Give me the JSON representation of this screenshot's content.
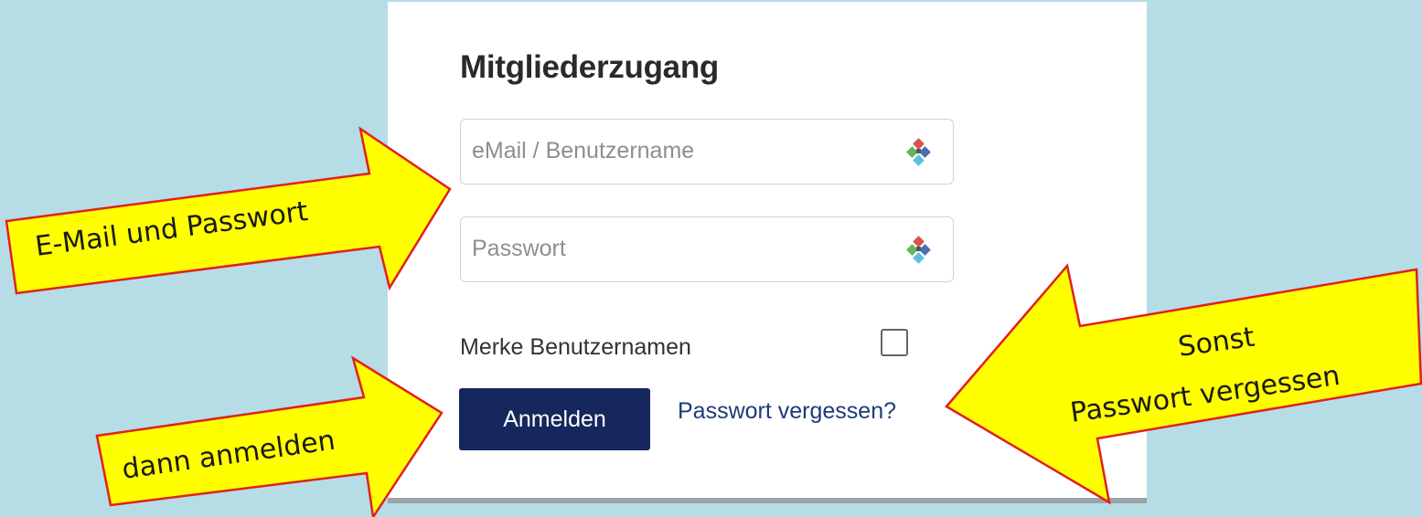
{
  "login": {
    "title": "Mitgliederzugang",
    "email_placeholder": "eMail / Benutzername",
    "password_placeholder": "Passwort",
    "remember_label": "Merke Benutzernamen",
    "remember_checked": false,
    "login_button": "Anmelden",
    "forgot_link": "Passwort vergessen?",
    "field_icon": "password-manager-icon"
  },
  "callouts": {
    "email_password": "E-Mail und Passwort",
    "then_login": "dann anmelden",
    "otherwise_line1": "Sonst",
    "otherwise_line2": "Passwort vergessen",
    "fill_color": "#ffff00",
    "stroke_color": "#e02020"
  },
  "colors": {
    "background": "#b6dce6",
    "panel": "#ffffff",
    "button": "#15275c",
    "link": "#1f3a78"
  }
}
